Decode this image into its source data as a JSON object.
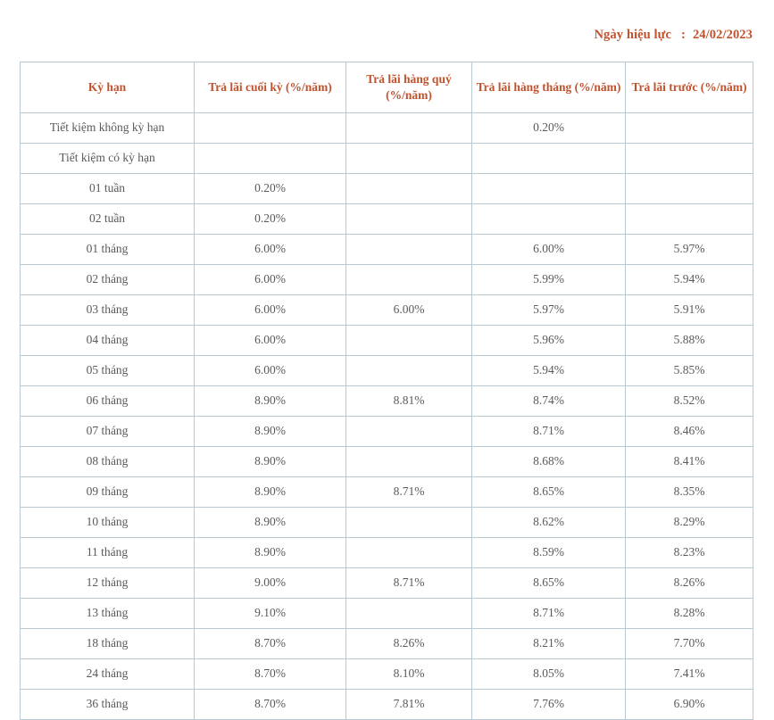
{
  "effective_date": {
    "label": "Ngày hiệu lực",
    "separator": ":",
    "value": "24/02/2023"
  },
  "colors": {
    "header_text": "#c1522e",
    "body_text": "#5a5a5a",
    "border": "#b9c9d1",
    "background": "#ffffff"
  },
  "table": {
    "columns": [
      "Kỳ hạn",
      "Trả lãi cuối  kỳ (%/năm)",
      "Trả lãi hàng quý (%/năm)",
      "Trả lãi hàng tháng (%/năm)",
      "Trả lãi trước (%/năm)"
    ],
    "rows": [
      {
        "term": "Tiết kiệm không kỳ hạn",
        "end_of_term": "",
        "quarterly": "",
        "monthly": "0.20%",
        "advance": ""
      },
      {
        "term": "Tiết kiệm có kỳ hạn",
        "end_of_term": "",
        "quarterly": "",
        "monthly": "",
        "advance": ""
      },
      {
        "term": "01 tuần",
        "end_of_term": "0.20%",
        "quarterly": "",
        "monthly": "",
        "advance": ""
      },
      {
        "term": "02 tuần",
        "end_of_term": "0.20%",
        "quarterly": "",
        "monthly": "",
        "advance": ""
      },
      {
        "term": "01 tháng",
        "end_of_term": "6.00%",
        "quarterly": "",
        "monthly": "6.00%",
        "advance": "5.97%"
      },
      {
        "term": "02 tháng",
        "end_of_term": "6.00%",
        "quarterly": "",
        "monthly": "5.99%",
        "advance": "5.94%"
      },
      {
        "term": "03 tháng",
        "end_of_term": "6.00%",
        "quarterly": "6.00%",
        "monthly": "5.97%",
        "advance": "5.91%"
      },
      {
        "term": "04 tháng",
        "end_of_term": "6.00%",
        "quarterly": "",
        "monthly": "5.96%",
        "advance": "5.88%"
      },
      {
        "term": "05 tháng",
        "end_of_term": "6.00%",
        "quarterly": "",
        "monthly": "5.94%",
        "advance": "5.85%"
      },
      {
        "term": "06 tháng",
        "end_of_term": "8.90%",
        "quarterly": "8.81%",
        "monthly": "8.74%",
        "advance": "8.52%"
      },
      {
        "term": "07 tháng",
        "end_of_term": "8.90%",
        "quarterly": "",
        "monthly": "8.71%",
        "advance": "8.46%"
      },
      {
        "term": "08 tháng",
        "end_of_term": "8.90%",
        "quarterly": "",
        "monthly": "8.68%",
        "advance": "8.41%"
      },
      {
        "term": "09 tháng",
        "end_of_term": "8.90%",
        "quarterly": "8.71%",
        "monthly": "8.65%",
        "advance": "8.35%"
      },
      {
        "term": "10 tháng",
        "end_of_term": "8.90%",
        "quarterly": "",
        "monthly": "8.62%",
        "advance": "8.29%"
      },
      {
        "term": "11 tháng",
        "end_of_term": "8.90%",
        "quarterly": "",
        "monthly": "8.59%",
        "advance": "8.23%"
      },
      {
        "term": "12 tháng",
        "end_of_term": "9.00%",
        "quarterly": "8.71%",
        "monthly": "8.65%",
        "advance": "8.26%"
      },
      {
        "term": "13 tháng",
        "end_of_term": "9.10%",
        "quarterly": "",
        "monthly": "8.71%",
        "advance": "8.28%"
      },
      {
        "term": "18 tháng",
        "end_of_term": "8.70%",
        "quarterly": "8.26%",
        "monthly": "8.21%",
        "advance": "7.70%"
      },
      {
        "term": "24 tháng",
        "end_of_term": "8.70%",
        "quarterly": "8.10%",
        "monthly": "8.05%",
        "advance": "7.41%"
      },
      {
        "term": "36 tháng",
        "end_of_term": "8.70%",
        "quarterly": "7.81%",
        "monthly": "7.76%",
        "advance": "6.90%"
      }
    ]
  }
}
